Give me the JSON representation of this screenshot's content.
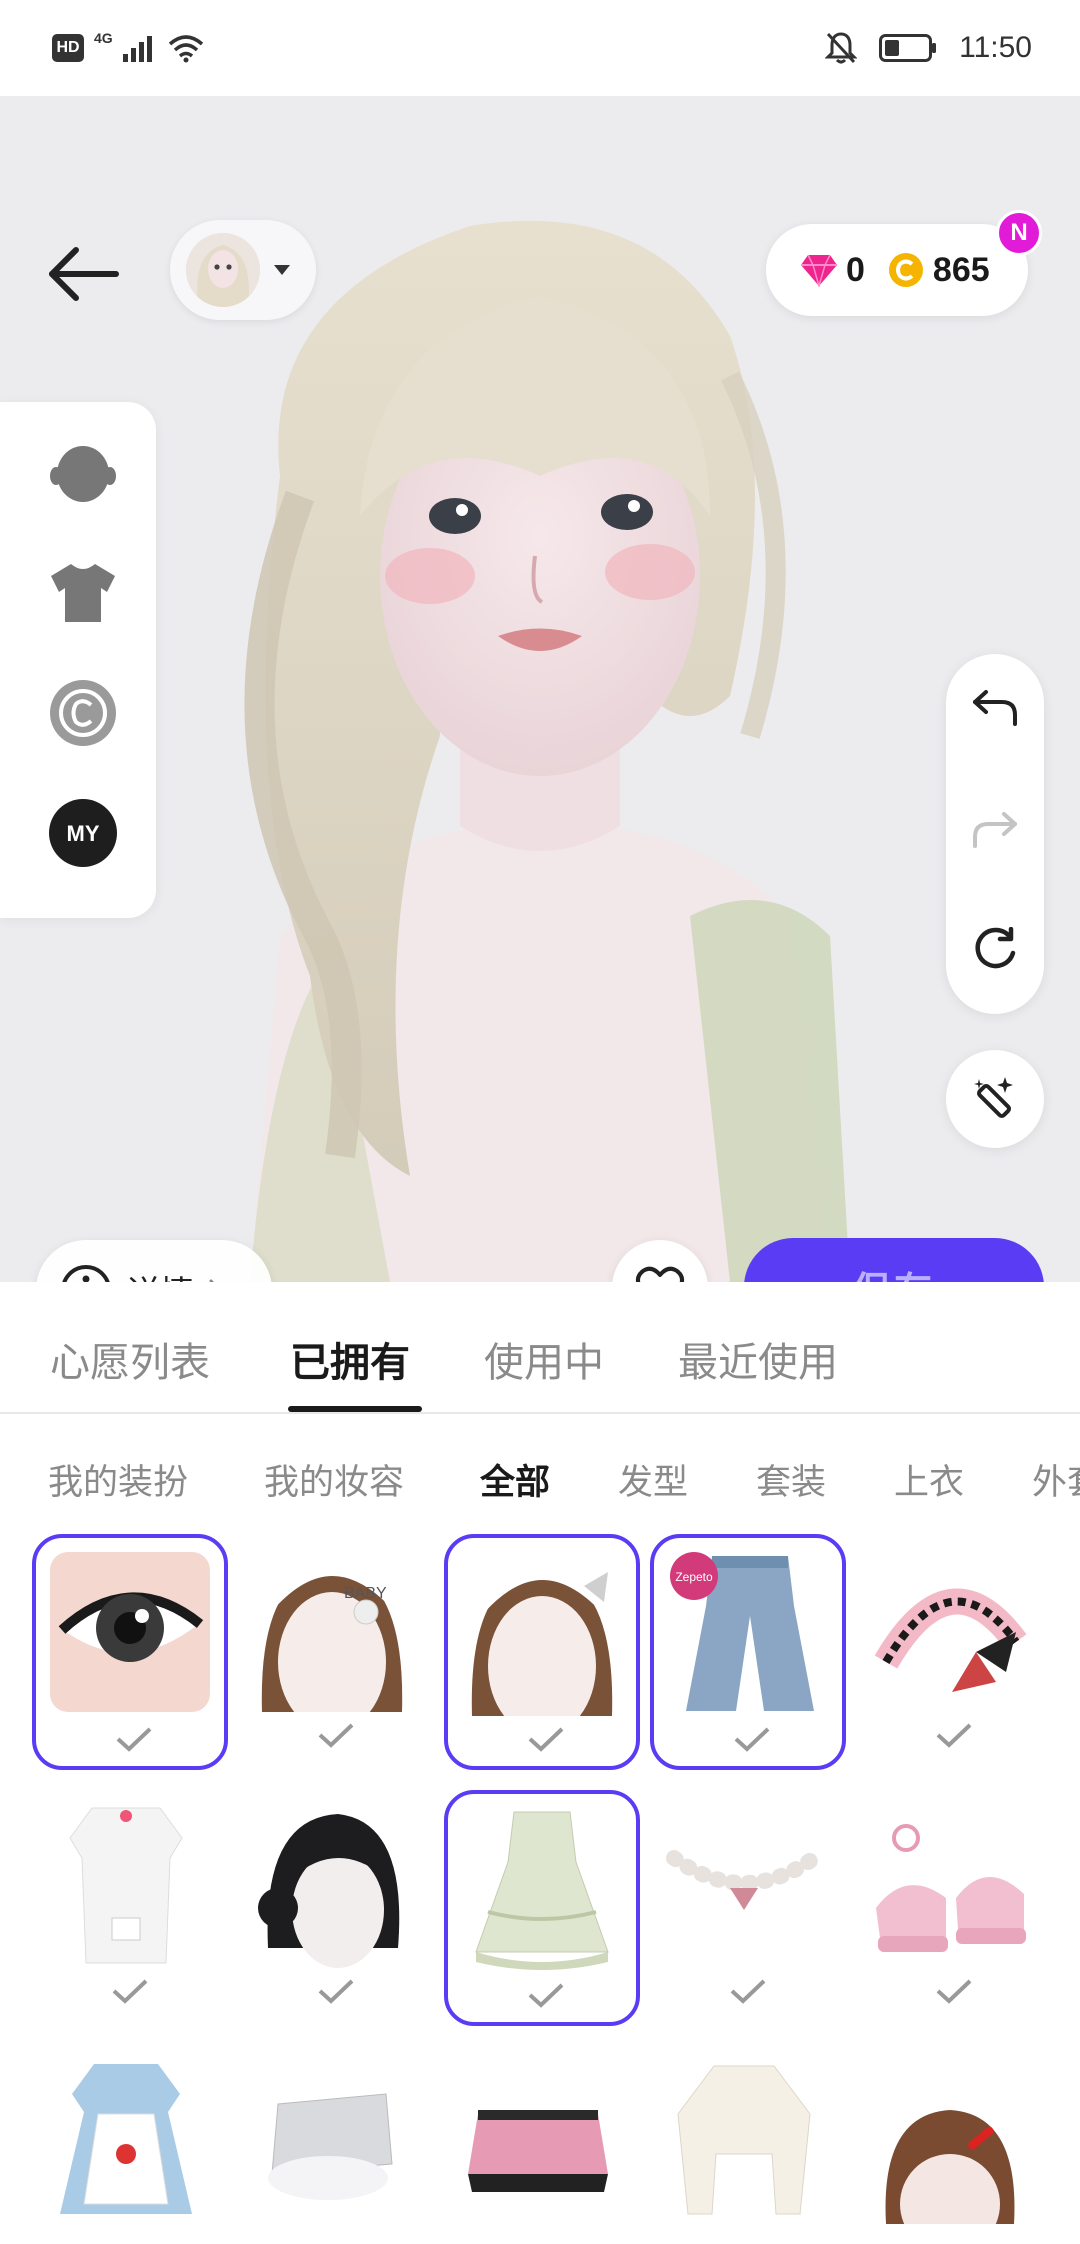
{
  "status_bar": {
    "hd": "HD",
    "network": "4G",
    "time": "11:50",
    "icons": [
      "signal-icon",
      "wifi-icon",
      "mute-bell-icon",
      "battery-icon"
    ]
  },
  "header": {
    "back_icon": "arrow-left-icon",
    "avatar_dropdown_icon": "caret-down-icon"
  },
  "currency": {
    "gems": "0",
    "coins": "865",
    "badge": "N",
    "gem_icon": "pink-gem-icon",
    "coin_icon": "gold-coin-icon"
  },
  "side_panel": {
    "items": [
      "head-icon",
      "shirt-icon",
      "copyright-icon",
      "my-icon"
    ],
    "my_label": "MY"
  },
  "right_tools": [
    "undo-icon",
    "redo-icon",
    "reset-icon",
    "magic-wand-icon"
  ],
  "actions": {
    "detail_label": "详情",
    "save_label": "保存"
  },
  "main_tabs": [
    {
      "label": "心愿列表",
      "active": false
    },
    {
      "label": "已拥有",
      "active": true
    },
    {
      "label": "使用中",
      "active": false
    },
    {
      "label": "最近使用",
      "active": false
    }
  ],
  "sub_tabs": [
    {
      "label": "我的装扮",
      "active": false
    },
    {
      "label": "我的妆容",
      "active": false
    },
    {
      "label": "全部",
      "active": true
    },
    {
      "label": "发型",
      "active": false
    },
    {
      "label": "套装",
      "active": false
    },
    {
      "label": "上衣",
      "active": false
    },
    {
      "label": "外套",
      "active": false
    }
  ],
  "items": [
    {
      "name": "eye-makeup-item",
      "selected": true
    },
    {
      "name": "hair-clip-bear-item",
      "selected": false
    },
    {
      "name": "hair-clip-bow-item",
      "selected": true
    },
    {
      "name": "flared-jeans-item",
      "selected": true
    },
    {
      "name": "lace-headband-item",
      "selected": false
    },
    {
      "name": "white-nurse-outfit-item",
      "selected": false
    },
    {
      "name": "black-bun-hair-item",
      "selected": false
    },
    {
      "name": "green-ruffle-dress-item",
      "selected": true
    },
    {
      "name": "pearl-necklace-item",
      "selected": false
    },
    {
      "name": "pink-platform-shoes-item",
      "selected": false
    },
    {
      "name": "gingham-apron-dress-item",
      "selected": false
    },
    {
      "name": "silver-fur-skirt-item",
      "selected": false
    },
    {
      "name": "pink-plaid-skirt-item",
      "selected": false
    },
    {
      "name": "cream-crop-top-item",
      "selected": false
    },
    {
      "name": "red-hair-clip-item",
      "selected": false
    }
  ],
  "colors": {
    "accent": "#5b3cf5",
    "save_text": "#b9b0ff",
    "badge": "#e21bd9",
    "gem": "#f0248f",
    "coin": "#f4b400"
  }
}
